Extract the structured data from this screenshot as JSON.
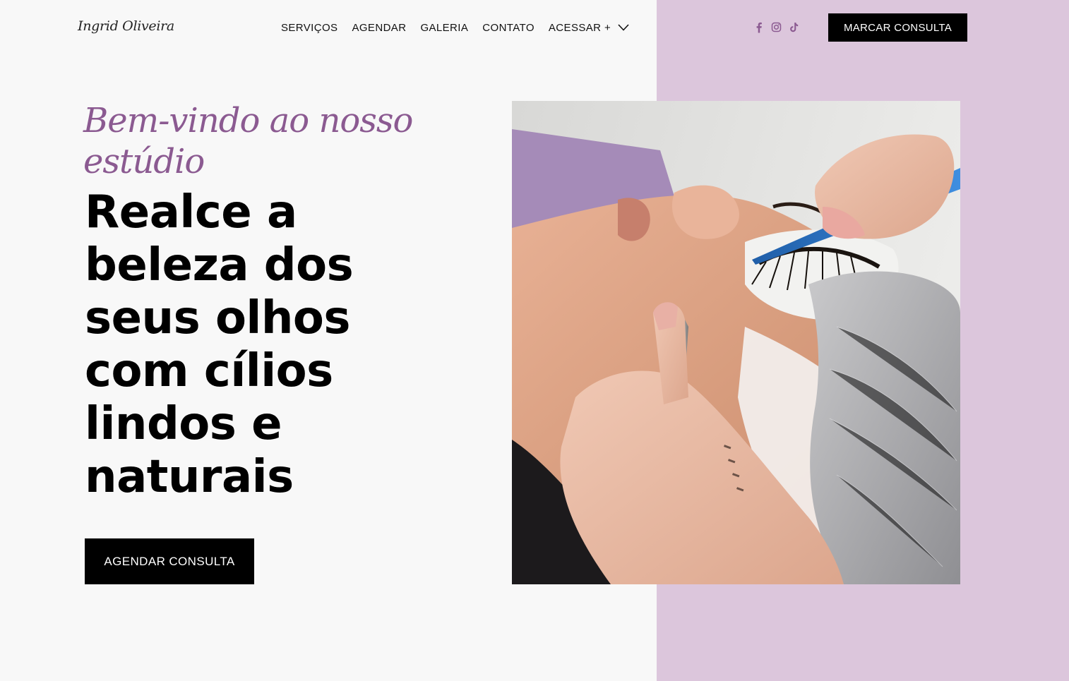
{
  "header": {
    "logo": "Ingrid Oliveira",
    "nav": [
      {
        "label": "SERVIÇOS"
      },
      {
        "label": "AGENDAR"
      },
      {
        "label": "GALERIA"
      },
      {
        "label": "CONTATO"
      },
      {
        "label": "ACESSAR +"
      }
    ],
    "socials": [
      {
        "icon": "facebook-icon"
      },
      {
        "icon": "instagram-icon"
      },
      {
        "icon": "tiktok-icon"
      }
    ],
    "cta_label": "MARCAR CONSULTA"
  },
  "hero": {
    "welcome": "Bem-vindo ao nosso estúdio",
    "headline": "Realce a beleza dos seus olhos com cílios lindos e naturais",
    "cta_label": "AGENDAR CONSULTA",
    "image_icon": "eyelash-extension-photo"
  },
  "colors": {
    "background": "#f8f8f8",
    "accent_panel": "#dcc6dc",
    "script_text": "#8b5a91",
    "social_icon": "#8b5a91",
    "button_bg": "#000000",
    "button_text": "#ffffff"
  }
}
